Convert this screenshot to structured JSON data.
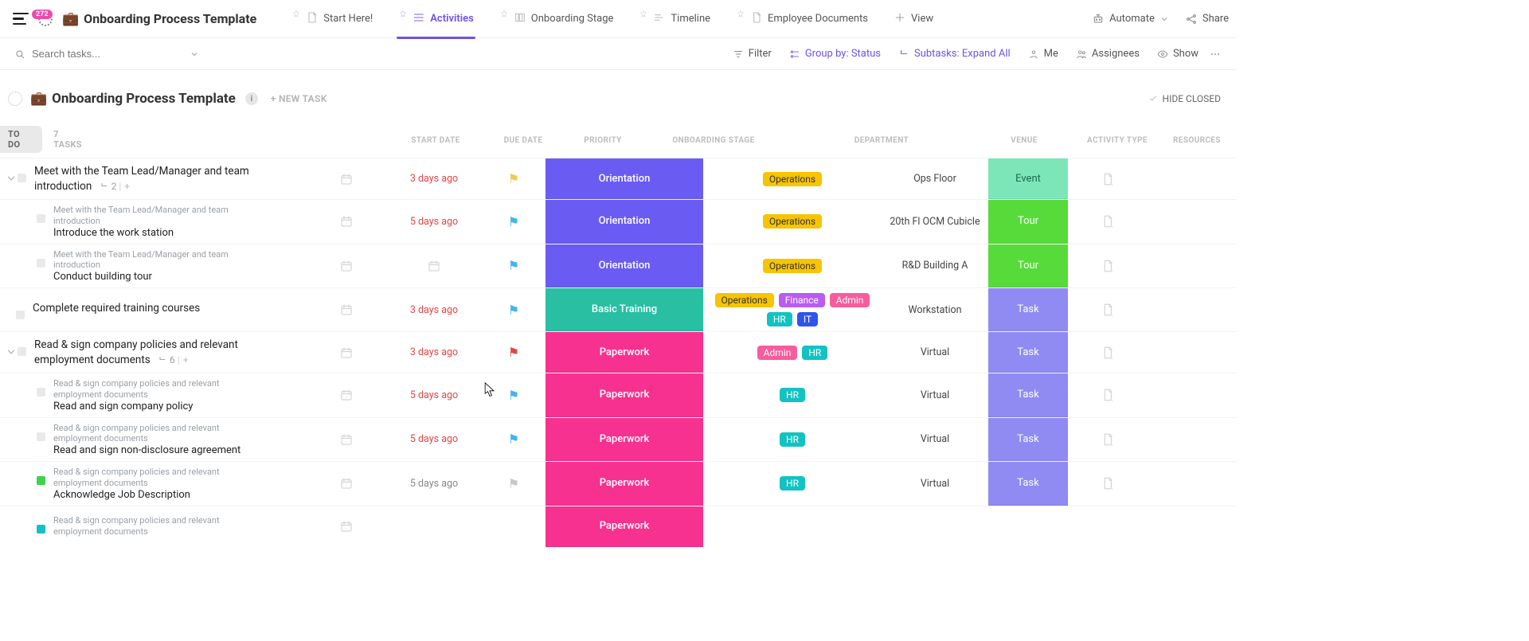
{
  "app": {
    "badge_count": "272",
    "project_emoji": "💼",
    "project_title": "Onboarding Process Template"
  },
  "tabs": [
    {
      "label": "Start Here!",
      "key": "start"
    },
    {
      "label": "Activities",
      "key": "activities",
      "active": true
    },
    {
      "label": "Onboarding Stage",
      "key": "stage"
    },
    {
      "label": "Timeline",
      "key": "timeline"
    },
    {
      "label": "Employee Documents",
      "key": "docs"
    },
    {
      "label": "View",
      "key": "addview",
      "is_add": true
    }
  ],
  "topright": {
    "automate": "Automate",
    "share": "Share"
  },
  "toolbar": {
    "search_placeholder": "Search tasks...",
    "filter": "Filter",
    "groupby": "Group by: Status",
    "subtasks": "Subtasks: Expand All",
    "me": "Me",
    "assignees": "Assignees",
    "show": "Show"
  },
  "list_header": {
    "emoji": "💼",
    "title": "Onboarding Process Template",
    "new_task": "+ NEW TASK",
    "hide_closed": "HIDE CLOSED"
  },
  "group": {
    "label": "TO DO",
    "count": "7 TASKS"
  },
  "columns": {
    "name": "",
    "start_date": "START DATE",
    "due_date": "DUE DATE",
    "priority": "PRIORITY",
    "stage": "ONBOARDING STAGE",
    "department": "DEPARTMENT",
    "venue": "VENUE",
    "activity_type": "ACTIVITY TYPE",
    "resources": "RESOURCES"
  },
  "stage_labels": {
    "orientation": "Orientation",
    "basic": "Basic Training",
    "paperwork": "Paperwork"
  },
  "activity_labels": {
    "event": "Event",
    "tour": "Tour",
    "task": "Task"
  },
  "dept_labels": {
    "operations": "Operations",
    "finance": "Finance",
    "admin": "Admin",
    "hr": "HR",
    "it": "IT"
  },
  "tasks": [
    {
      "type": "parent",
      "title": "Meet with the Team Lead/Manager and team introduction",
      "sub_badge_icon": true,
      "sub_count": "2",
      "due": "3 days ago",
      "due_cls": "red",
      "flag": "yellow",
      "stage": "orientation",
      "departments": [
        "operations"
      ],
      "venue": "Ops Floor",
      "activity": "event"
    },
    {
      "type": "sub",
      "breadcrumb": "Meet with the Team Lead/Manager and team introduction",
      "title": "Introduce the work station",
      "due": "5 days ago",
      "due_cls": "red",
      "flag": "blue",
      "stage": "orientation",
      "departments": [
        "operations"
      ],
      "venue": "20th Fl OCM Cubicle",
      "activity": "tour"
    },
    {
      "type": "sub",
      "breadcrumb": "Meet with the Team Lead/Manager and team introduction",
      "title": "Conduct building tour",
      "due": "",
      "due_cls": "icon",
      "flag": "blue",
      "stage": "orientation",
      "departments": [
        "operations"
      ],
      "venue": "R&D Building A",
      "activity": "tour"
    },
    {
      "type": "single",
      "title": "Complete required training courses",
      "due": "3 days ago",
      "due_cls": "red",
      "flag": "blue",
      "stage": "basic",
      "departments": [
        "operations",
        "finance",
        "admin",
        "hr",
        "it"
      ],
      "venue": "Workstation",
      "activity": "task"
    },
    {
      "type": "parent",
      "title": "Read & sign company policies and relevant employment documents",
      "sub_badge_icon": true,
      "sub_count": "6",
      "due": "3 days ago",
      "due_cls": "red",
      "flag": "red",
      "stage": "paperwork",
      "departments": [
        "admin",
        "hr"
      ],
      "venue": "Virtual",
      "activity": "task"
    },
    {
      "type": "sub",
      "breadcrumb": "Read & sign company policies and relevant employment documents",
      "title": "Read and sign company policy",
      "due": "5 days ago",
      "due_cls": "red",
      "flag": "blue",
      "stage": "paperwork",
      "departments": [
        "hr"
      ],
      "venue": "Virtual",
      "activity": "task"
    },
    {
      "type": "sub",
      "breadcrumb": "Read & sign company policies and relevant employment documents",
      "title": "Read and sign non-disclosure agreement",
      "due": "5 days ago",
      "due_cls": "red",
      "flag": "blue",
      "stage": "paperwork",
      "departments": [
        "hr"
      ],
      "venue": "Virtual",
      "activity": "task"
    },
    {
      "type": "sub",
      "status": "green",
      "breadcrumb": "Read & sign company policies and relevant employment documents",
      "title": "Acknowledge Job Description",
      "due": "5 days ago",
      "due_cls": "gray",
      "flag": "gray",
      "stage": "paperwork",
      "departments": [
        "hr"
      ],
      "venue": "Virtual",
      "activity": "task"
    },
    {
      "type": "sub",
      "status": "teal",
      "breadcrumb": "Read & sign company policies and relevant employment documents",
      "title": "",
      "due": "",
      "due_cls": "",
      "flag": "",
      "stage": "paperwork",
      "departments": [],
      "venue": "",
      "activity": "",
      "partial": true
    }
  ]
}
